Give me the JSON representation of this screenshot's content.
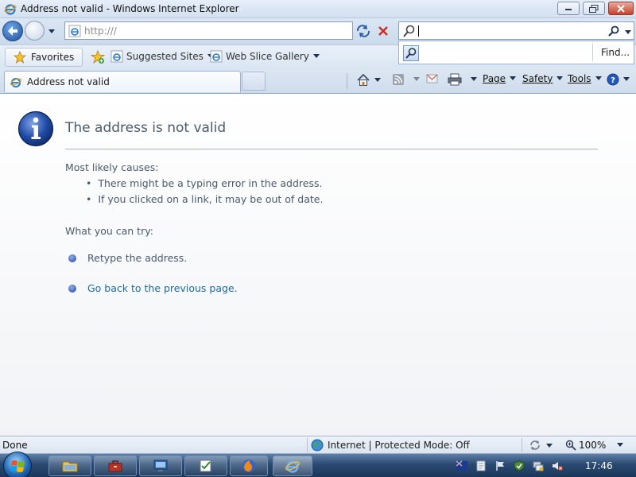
{
  "window": {
    "title": "Address not valid - Windows Internet Explorer"
  },
  "navigation": {
    "address_value": "http:///"
  },
  "search": {
    "value": "",
    "find_label": "Find..."
  },
  "favorites_bar": {
    "favorites_label": "Favorites",
    "items": [
      {
        "label": "Suggested Sites"
      },
      {
        "label": "Web Slice Gallery"
      }
    ]
  },
  "tabs": [
    {
      "label": "Address not valid",
      "active": true
    }
  ],
  "command_bar": {
    "page_label": "Page",
    "safety_label": "Safety",
    "tools_label": "Tools"
  },
  "error_page": {
    "title": "The address is not valid",
    "causes_heading": "Most likely causes:",
    "causes": [
      "There might be a typing error in the address.",
      "If you clicked on a link, it may be out of date."
    ],
    "try_heading": "What you can try:",
    "actions": [
      {
        "label": "Retype the address.",
        "is_link": false
      },
      {
        "label": "Go back to the previous page.",
        "is_link": true
      }
    ]
  },
  "status_bar": {
    "status": "Done",
    "zone": "Internet | Protected Mode: Off",
    "zoom": "100%"
  },
  "taskbar": {
    "clock": "17:46"
  },
  "colors": {
    "title_text": "#4a5a6e",
    "link": "#1c6aa8",
    "info_icon": "#1f4aa3"
  }
}
